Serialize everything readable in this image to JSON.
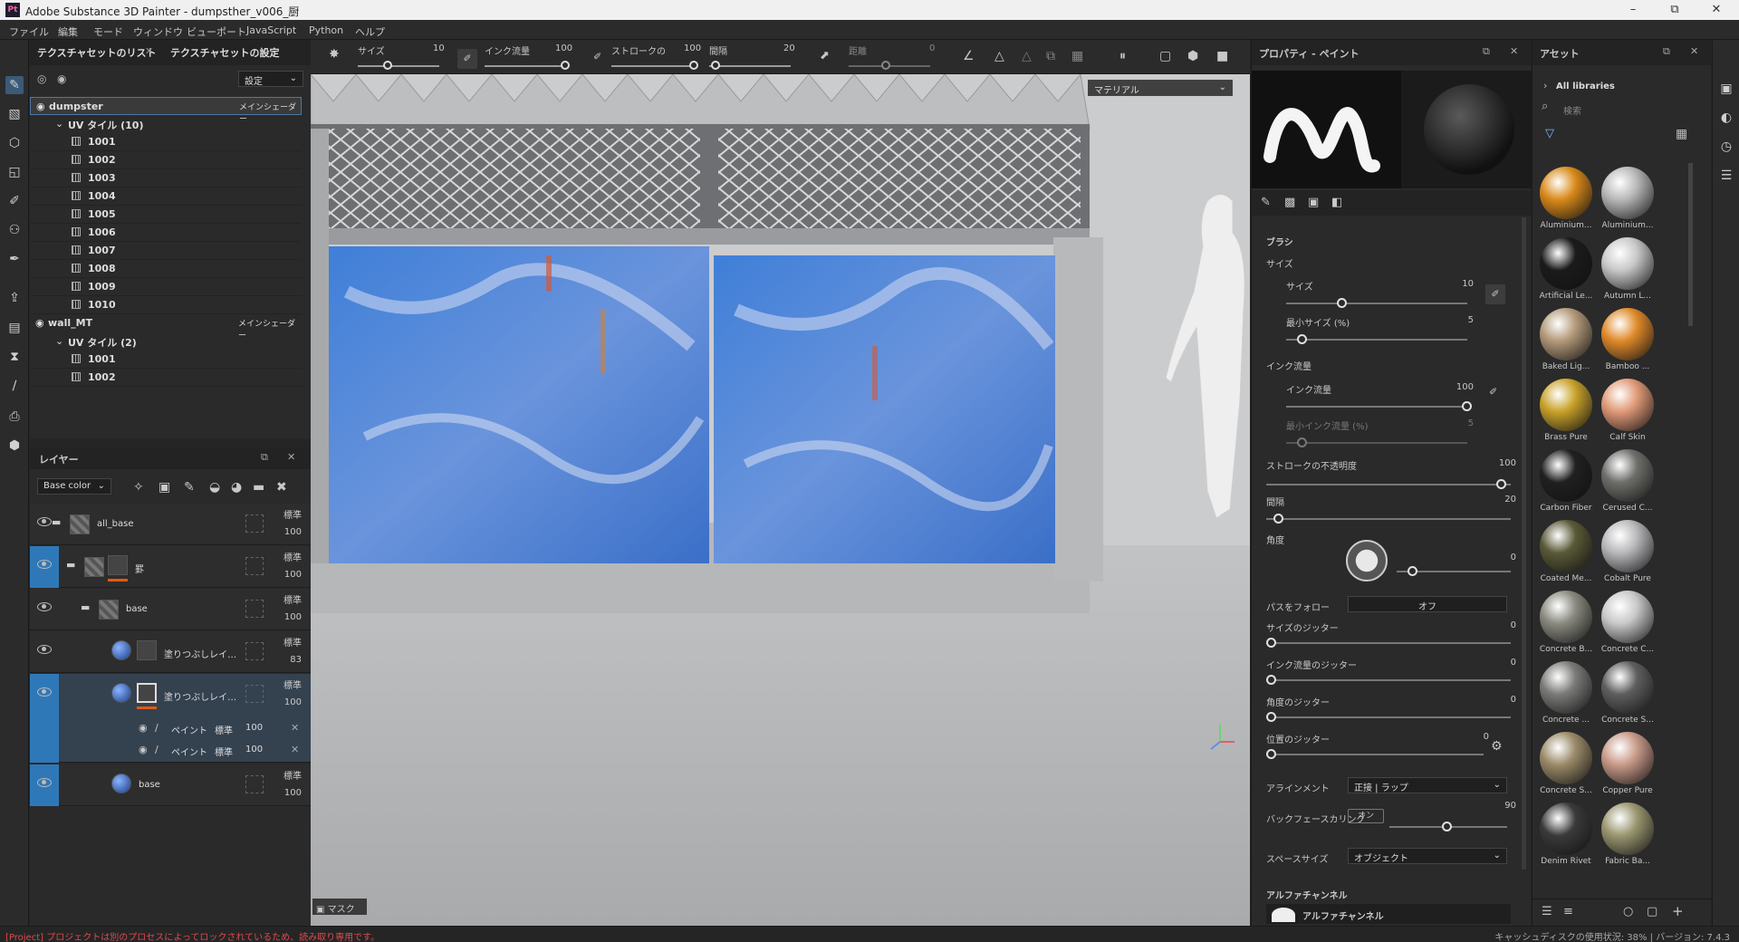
{
  "titlebar": {
    "app_icon": "Pt",
    "title": "Adobe Substance 3D Painter - dumpsther_v006_厨"
  },
  "menu": [
    "ファイル",
    "編集",
    "モード",
    "ウィンドウ",
    "ビューポート",
    "JavaScript",
    "Python",
    "ヘルプ"
  ],
  "texture_sets": {
    "tab_list": "テクスチャセットのリスト",
    "tab_settings": "テクスチャセットの設定",
    "settings_dropdown": "設定",
    "sets": [
      {
        "name": "dumpster",
        "shader": "メインシェーダー",
        "uv_header": "UV タイル (10)",
        "tiles": [
          "1001",
          "1002",
          "1003",
          "1004",
          "1005",
          "1006",
          "1007",
          "1008",
          "1009",
          "1010"
        ]
      },
      {
        "name": "wall_MT",
        "shader": "メインシェーダー",
        "uv_header": "UV タイル (2)",
        "tiles": [
          "1001",
          "1002"
        ]
      }
    ]
  },
  "layers": {
    "title": "レイヤー",
    "channel_dropdown": "Base color",
    "rows": [
      {
        "name": "all_base",
        "blend": "標準",
        "opacity": "100"
      },
      {
        "name": "罫",
        "blend": "標準",
        "opacity": "100"
      },
      {
        "name": "base",
        "blend": "標準",
        "opacity": "100"
      },
      {
        "name": "塗りつぶしレイ…",
        "blend": "標準",
        "opacity": "83"
      },
      {
        "name": "塗りつぶしレイ…",
        "blend": "標準",
        "opacity": "100"
      },
      {
        "name": "base",
        "blend": "標準",
        "opacity": "100"
      }
    ],
    "effects": [
      {
        "name": "ペイント",
        "blend": "標準",
        "opacity": "100"
      },
      {
        "name": "ペイント",
        "blend": "標準",
        "opacity": "100"
      }
    ]
  },
  "viewport_toolbar": {
    "size_label": "サイズ",
    "size_value": "10",
    "flow_label": "インク流量",
    "flow_value": "100",
    "stroke_label": "ストロークの",
    "stroke_value": "100",
    "spacing_label": "間隔",
    "spacing_value": "20",
    "distance_label": "距離",
    "distance_value": "0"
  },
  "viewport": {
    "material_dropdown": "マテリアル",
    "mask_label": "マスク"
  },
  "properties": {
    "title": "プロパティ - ペイント",
    "brush_section": "ブラシ",
    "size_group": "サイズ",
    "size_label": "サイズ",
    "size_value": "10",
    "min_size_label": "最小サイズ (%)",
    "min_size_value": "5",
    "flow_group": "インク流量",
    "flow_label": "インク流量",
    "flow_value": "100",
    "min_flow_label": "最小インク流量 (%)",
    "min_flow_value": "5",
    "stroke_opacity_label": "ストロークの不透明度",
    "stroke_opacity_value": "100",
    "spacing_label": "間隔",
    "spacing_value": "20",
    "angle_label": "角度",
    "angle_value": "0",
    "follow_path_label": "パスをフォロー",
    "follow_path_value": "オフ",
    "size_jitter_label": "サイズのジッター",
    "size_jitter_value": "0",
    "flow_jitter_label": "インク流量のジッター",
    "flow_jitter_value": "0",
    "angle_jitter_label": "角度のジッター",
    "angle_jitter_value": "0",
    "position_jitter_label": "位置のジッター",
    "position_jitter_value": "0",
    "alignment_label": "アラインメント",
    "alignment_value": "正接 | ラップ",
    "backface_label": "バックフェースカリング",
    "backface_toggle": "オン",
    "backface_value": "90",
    "space_size_label": "スペースサイズ",
    "space_size_value": "オブジェクト",
    "alpha_section": "アルファチャンネル",
    "alpha_item": "アルファチャンネル"
  },
  "assets": {
    "title": "アセット",
    "library": "All libraries",
    "search_placeholder": "検索",
    "items": [
      {
        "name": "Aluminium...",
        "color": "#d98a1a"
      },
      {
        "name": "Aluminium...",
        "color": "#b8b8b8"
      },
      {
        "name": "Artificial Le...",
        "color": "#1b1b1b"
      },
      {
        "name": "Autumn L...",
        "color": "#c8c8c8"
      },
      {
        "name": "Baked Lig...",
        "color": "#b39a7a"
      },
      {
        "name": "Bamboo ...",
        "color": "#e08a2a"
      },
      {
        "name": "Brass Pure",
        "color": "#c9a22a"
      },
      {
        "name": "Calf Skin",
        "color": "#e09a78"
      },
      {
        "name": "Carbon Fiber",
        "color": "#202020"
      },
      {
        "name": "Cerused C...",
        "color": "#6e6e6a"
      },
      {
        "name": "Coated Me...",
        "color": "#5a5a38"
      },
      {
        "name": "Cobalt Pure",
        "color": "#b8b8bc"
      },
      {
        "name": "Concrete B...",
        "color": "#8a8a80"
      },
      {
        "name": "Concrete C...",
        "color": "#c8c8c8"
      },
      {
        "name": "Concrete ...",
        "color": "#7a7a78"
      },
      {
        "name": "Concrete S...",
        "color": "#5e5e5e"
      },
      {
        "name": "Concrete S...",
        "color": "#9a8a68"
      },
      {
        "name": "Copper Pure",
        "color": "#c89a88"
      },
      {
        "name": "Denim Rivet",
        "color": "#3a3a3a"
      },
      {
        "name": "Fabric Ba...",
        "color": "#9a9670"
      }
    ]
  },
  "statusbar": {
    "message": "[Project] プロジェクトは別のプロセスによってロックされているため、読み取り専用です。",
    "cache_info": "キャッシュディスクの使用状況: 38% | バージョン: 7.4.3"
  }
}
